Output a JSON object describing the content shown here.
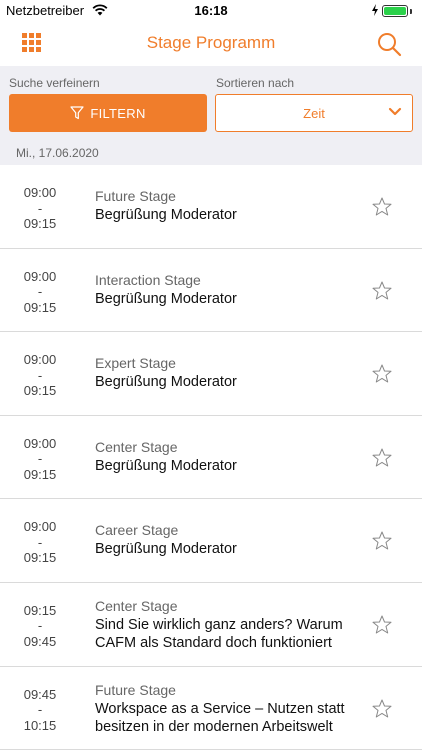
{
  "status_bar": {
    "carrier": "Netzbetreiber",
    "time": "16:18",
    "battery_color": "#2bd14a"
  },
  "nav": {
    "title": "Stage Programm",
    "left_icon": "grid-icon",
    "right_icon": "search-icon",
    "accent": "#f07d2b"
  },
  "filters": {
    "refine_label": "Suche verfeinern",
    "sort_label": "Sortieren nach",
    "filter_button": "FILTERN",
    "sort_value": "Zeit"
  },
  "date_header": "Mi., 17.06.2020",
  "sessions": [
    {
      "start": "09:00",
      "sep": "-",
      "end": "09:15",
      "stage": "Future Stage",
      "title": "Begrüßung Moderator",
      "favorite": false
    },
    {
      "start": "09:00",
      "sep": "-",
      "end": "09:15",
      "stage": "Interaction Stage",
      "title": "Begrüßung Moderator",
      "favorite": false
    },
    {
      "start": "09:00",
      "sep": "-",
      "end": "09:15",
      "stage": "Expert Stage",
      "title": "Begrüßung Moderator",
      "favorite": false
    },
    {
      "start": "09:00",
      "sep": "-",
      "end": "09:15",
      "stage": "Center Stage",
      "title": "Begrüßung Moderator",
      "favorite": false
    },
    {
      "start": "09:00",
      "sep": "-",
      "end": "09:15",
      "stage": "Career Stage",
      "title": "Begrüßung Moderator",
      "favorite": false
    },
    {
      "start": "09:15",
      "sep": "-",
      "end": "09:45",
      "stage": "Center Stage",
      "title": "Sind Sie wirklich ganz anders? Warum CAFM als Standard doch funktioniert",
      "favorite": false
    },
    {
      "start": "09:45",
      "sep": "-",
      "end": "10:15",
      "stage": "Future Stage",
      "title": "Workspace as a Service – Nutzen statt besitzen in der modernen Arbeitswelt",
      "favorite": false
    }
  ]
}
